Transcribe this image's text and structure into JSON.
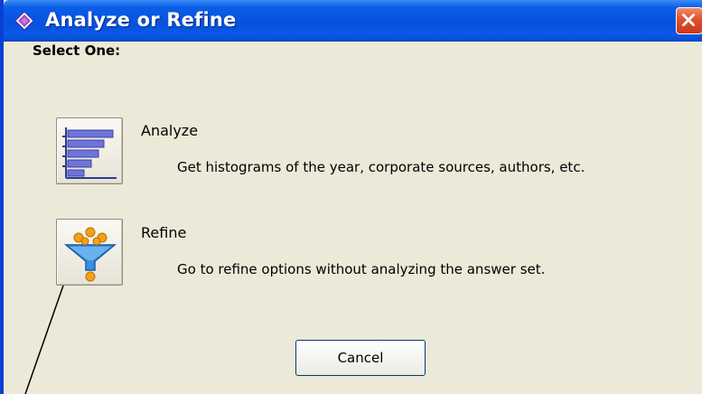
{
  "window": {
    "title": "Analyze or Refine",
    "app_icon": "diamond-app-icon",
    "close_icon": "close-x-icon",
    "titlebar_color": "#0752dc",
    "close_color": "#e0502b"
  },
  "dialog": {
    "prompt": "Select One:",
    "options": [
      {
        "title": "Analyze",
        "description": "Get histograms of the year, corporate sources, authors, etc.",
        "icon": "histogram-icon"
      },
      {
        "title": "Refine",
        "description": "Go to refine options without analyzing the answer set.",
        "icon": "funnel-icon"
      }
    ],
    "cancel_label": "Cancel"
  }
}
